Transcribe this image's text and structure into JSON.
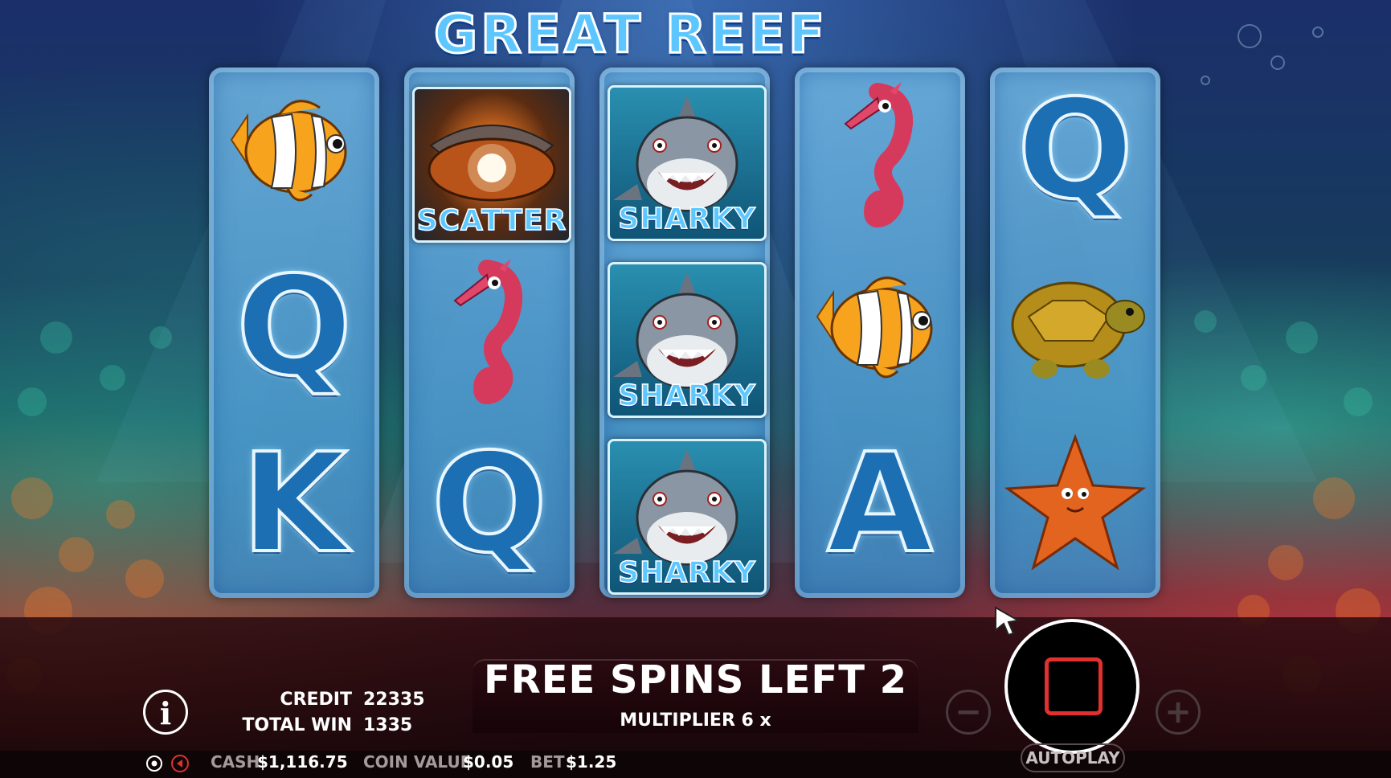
{
  "game": {
    "title": "GREAT REEF"
  },
  "reels": [
    [
      {
        "symbol": "clownfish"
      },
      {
        "symbol": "Q"
      },
      {
        "symbol": "K"
      }
    ],
    [
      {
        "symbol": "scatter",
        "label": "SCATTER"
      },
      {
        "symbol": "seahorse"
      },
      {
        "symbol": "Q"
      }
    ],
    [
      {
        "symbol": "sharky",
        "label": "SHARKY"
      },
      {
        "symbol": "sharky",
        "label": "SHARKY"
      },
      {
        "symbol": "sharky",
        "label": "SHARKY"
      }
    ],
    [
      {
        "symbol": "seahorse"
      },
      {
        "symbol": "clownfish"
      },
      {
        "symbol": "A"
      }
    ],
    [
      {
        "symbol": "Q"
      },
      {
        "symbol": "turtle"
      },
      {
        "symbol": "starfish"
      }
    ]
  ],
  "free_spins": {
    "text": "FREE SPINS LEFT 2",
    "multiplier_text": "MULTIPLIER 6 x"
  },
  "stats": {
    "credit_label": "CREDIT",
    "credit_value": "22335",
    "total_win_label": "TOTAL WIN",
    "total_win_value": "1335"
  },
  "bottom_bar": {
    "cash_label": "CASH",
    "cash_value": "$1,116.75",
    "coin_value_label": "COIN VALUE",
    "coin_value_value": "$0.05",
    "bet_label": "BET",
    "bet_value": "$1.25"
  },
  "controls": {
    "autoplay_label": "AUTOPLAY",
    "info_label": "i",
    "minus_label": "−",
    "plus_label": "+"
  },
  "icons": [
    "settings-icon",
    "sound-icon",
    "info-icon",
    "stop-icon",
    "cursor-icon"
  ],
  "colors": {
    "title_blue": "#5ec6ff",
    "stop_red": "#e0312f",
    "panel_dark": "#160408"
  }
}
